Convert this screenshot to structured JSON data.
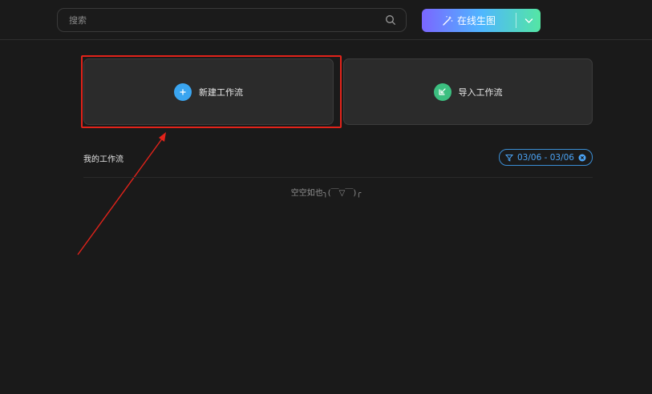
{
  "search": {
    "placeholder": "搜索",
    "icon": "search-icon"
  },
  "generate_button": {
    "label": "在线生图",
    "icon": "magic-wand-icon",
    "dropdown_icon": "chevron-down-icon",
    "gradient": [
      "#7b66ff",
      "#4fb6ff",
      "#54e6a4"
    ]
  },
  "cards": {
    "new_workflow": {
      "label": "新建工作流",
      "icon": "plus-icon",
      "color": "#3aa5f0"
    },
    "import_workflow": {
      "label": "导入工作流",
      "icon": "import-icon",
      "color": "#3cbf80"
    }
  },
  "workflows": {
    "title": "我的工作流",
    "date_filter": {
      "label": "03/06 - 03/06",
      "icon": "filter-icon",
      "clear_icon": "clear-icon",
      "color": "#4aa3f5"
    },
    "empty_text": "空空如也╮(￣▽￣)╭"
  },
  "annotation": {
    "color": "#e2231a"
  }
}
